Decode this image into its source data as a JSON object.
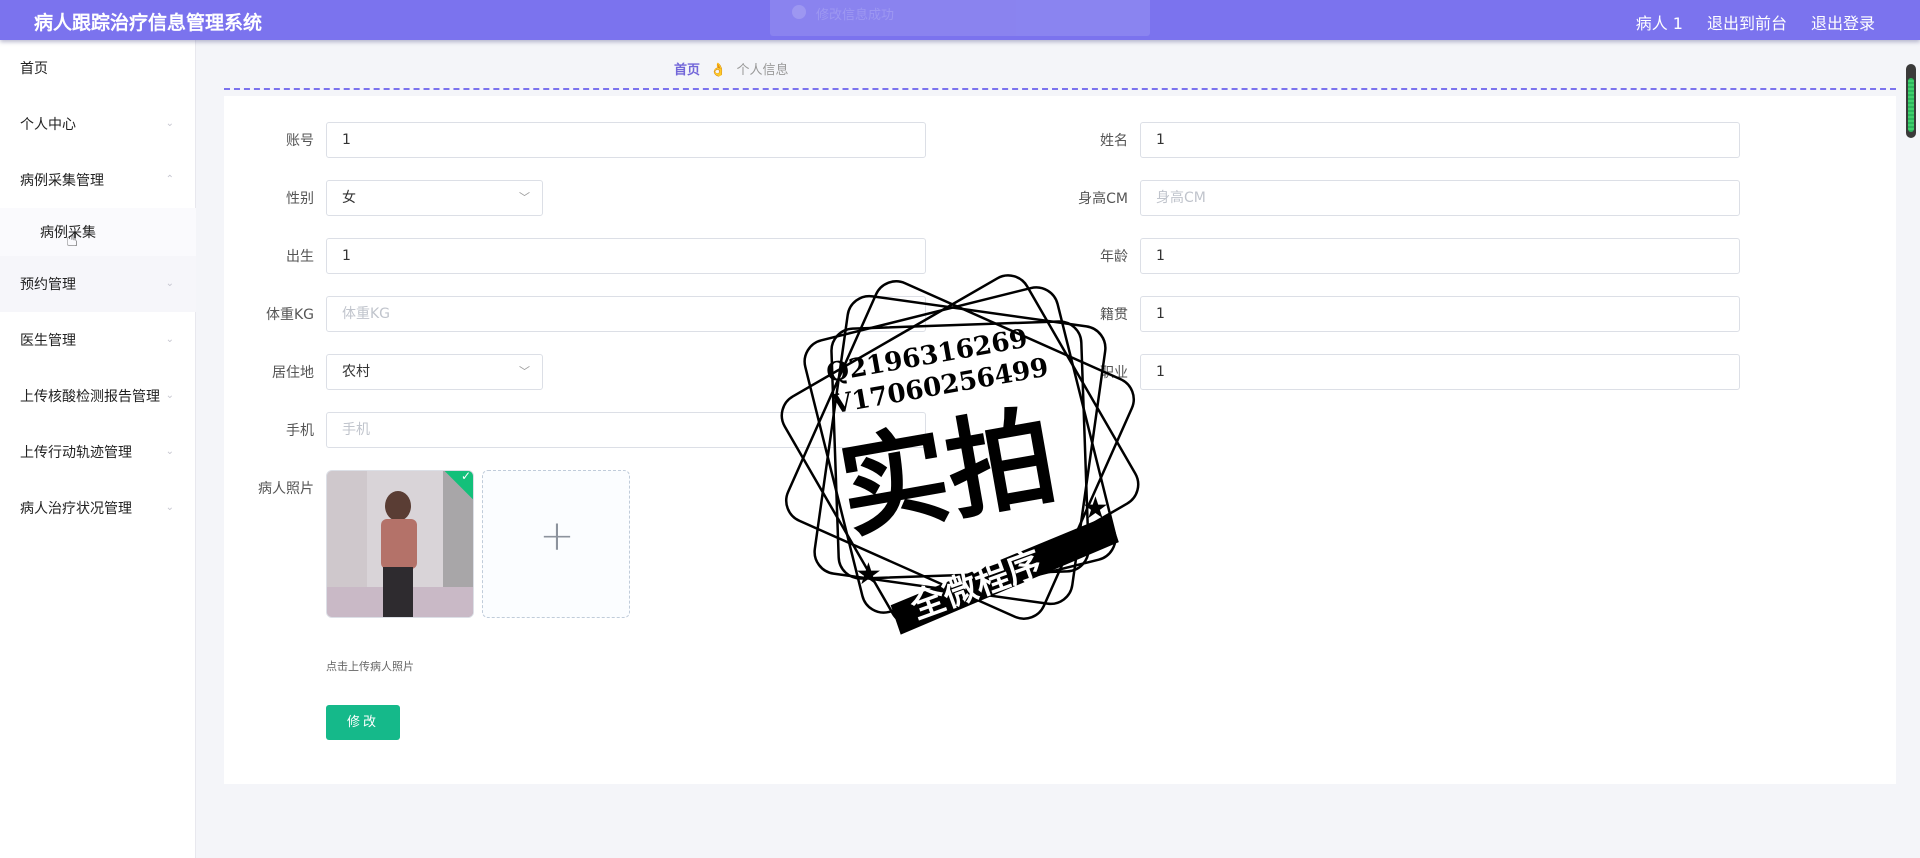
{
  "header": {
    "app_title": "病人跟踪治疗信息管理系统",
    "toast": "修改信息成功",
    "links": [
      "病人 1",
      "退出到前台",
      "退出登录"
    ],
    "color": "#7b73ee"
  },
  "sidebar": {
    "items": [
      {
        "label": "首页",
        "chevron": ""
      },
      {
        "label": "个人中心",
        "chevron": "⌄"
      },
      {
        "label": "病例采集管理",
        "chevron": "⌃"
      },
      {
        "label": "病例采集",
        "chevron": ""
      },
      {
        "label": "预约管理",
        "chevron": "⌄"
      },
      {
        "label": "医生管理",
        "chevron": "⌄"
      },
      {
        "label": "上传核酸检测报告管理",
        "chevron": "⌄"
      },
      {
        "label": "上传行动轨迹管理",
        "chevron": "⌄"
      },
      {
        "label": "病人治疗状况管理",
        "chevron": "⌄"
      }
    ]
  },
  "breadcrumb": {
    "home": "首页",
    "separator_icon": "👌",
    "current": "个人信息"
  },
  "form": {
    "account": {
      "label": "账号",
      "value": "1"
    },
    "name": {
      "label": "姓名",
      "value": "1"
    },
    "gender": {
      "label": "性别",
      "value": "女"
    },
    "height": {
      "label": "身高CM",
      "placeholder": "身高CM"
    },
    "birth": {
      "label": "出生",
      "value": "1"
    },
    "age": {
      "label": "年龄",
      "value": "1"
    },
    "weight": {
      "label": "体重KG",
      "placeholder": "体重KG"
    },
    "native": {
      "label": "籍贯",
      "value": "1"
    },
    "residence": {
      "label": "居住地",
      "value": "农村"
    },
    "job": {
      "label": "职业",
      "value": "1"
    },
    "phone": {
      "label": "手机",
      "placeholder": "手机"
    },
    "photo": {
      "label": "病人照片",
      "hint": "点击上传病人照片",
      "plus": "+"
    },
    "submit_label": "修改"
  },
  "stamp": {
    "line1": "Q2196316269",
    "line2": "V17060256499",
    "big": "实拍",
    "band": "全微程序"
  },
  "accent": {
    "button": "#15b98a",
    "breadcrumb": "#7266d9"
  }
}
